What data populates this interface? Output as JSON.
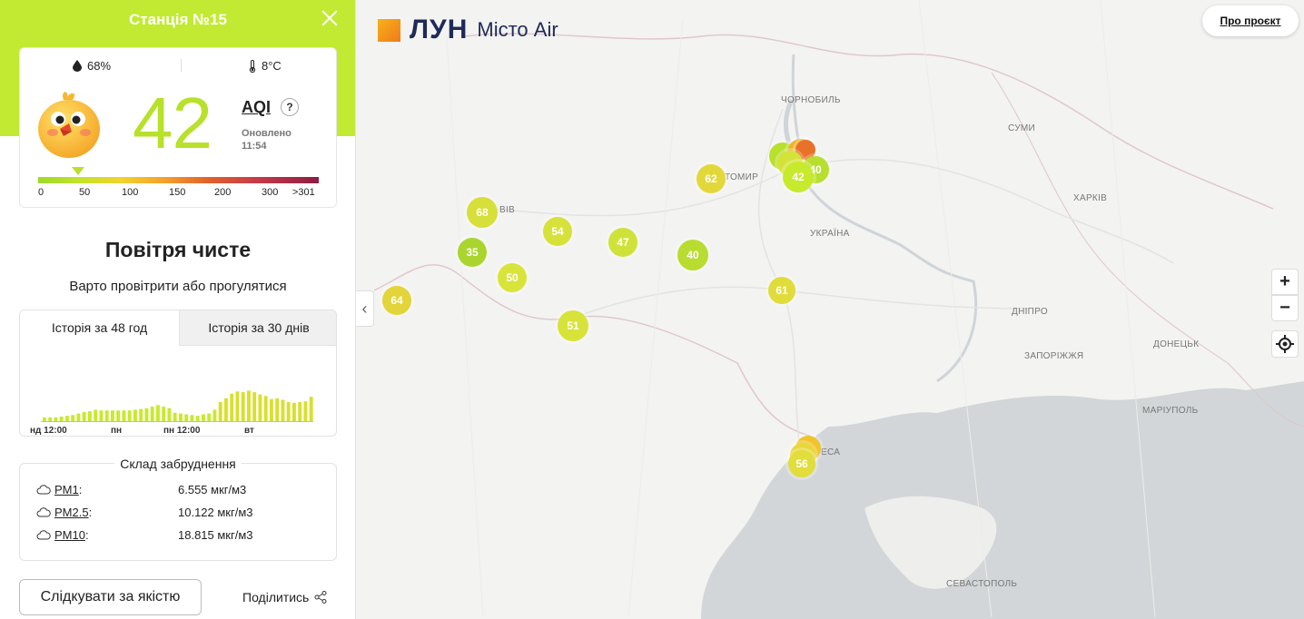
{
  "panel": {
    "title": "Станція №15",
    "humidity": "68%",
    "temperature": "8°C",
    "aqi_value": "42",
    "aqi_label": "AQI",
    "help": "?",
    "updated_label": "Оновлено",
    "updated_time": "11:54",
    "scale_ticks": [
      "0",
      "50",
      "100",
      "150",
      "200",
      "300",
      ">301"
    ],
    "status_title": "Повітря чисте",
    "status_sub": "Варто провітрити або прогулятися"
  },
  "history": {
    "tabs": [
      "Історія за 48 год",
      "Історія за 30 днів"
    ],
    "active_tab": 0,
    "time_labels": [
      "нд 12:00",
      "пн",
      "пн 12:00",
      "вт"
    ],
    "bars": [
      0.1,
      0.1,
      0.1,
      0.12,
      0.14,
      0.16,
      0.2,
      0.24,
      0.26,
      0.3,
      0.28,
      0.28,
      0.28,
      0.28,
      0.28,
      0.28,
      0.3,
      0.32,
      0.34,
      0.38,
      0.42,
      0.38,
      0.34,
      0.22,
      0.2,
      0.18,
      0.16,
      0.14,
      0.18,
      0.2,
      0.3,
      0.5,
      0.6,
      0.72,
      0.78,
      0.76,
      0.8,
      0.76,
      0.7,
      0.66,
      0.58,
      0.6,
      0.56,
      0.5,
      0.48,
      0.5,
      0.52,
      0.64
    ],
    "bar_colors": [
      "#c7ea2c",
      "#d8e02d"
    ]
  },
  "pollution": {
    "title": "Склад забруднення",
    "items": [
      {
        "name": "PM1",
        "value": "6.555 мкг/м3"
      },
      {
        "name": "PM2.5",
        "value": "10.122 мкг/м3"
      },
      {
        "name": "PM10",
        "value": "18.815 мкг/м3"
      }
    ]
  },
  "actions": {
    "follow": "Слідкувати за якістю",
    "share": "Поділитись"
  },
  "map": {
    "logo_main": "ЛУН",
    "logo_sub": "Місто Air",
    "about": "Про проєкт",
    "zoom_in": "+",
    "zoom_out": "−",
    "collapse_icon": "‹",
    "cities": [
      {
        "name": "ЧОРНОБИЛЬ"
      },
      {
        "name": "СУМИ"
      },
      {
        "name": "ТОМИР"
      },
      {
        "name": "ХАРКІВ"
      },
      {
        "name": "УКРАЇНА"
      },
      {
        "name": "ВІВ"
      },
      {
        "name": "ДНІПРО"
      },
      {
        "name": "ЗАПОРІЖЖЯ"
      },
      {
        "name": "ДОНЕЦЬК"
      },
      {
        "name": "МАРІУПОЛЬ"
      },
      {
        "name": "ЕСА"
      },
      {
        "name": "СЕВАСТОПОЛЬ"
      }
    ],
    "markers": [
      {
        "value": "68",
        "color": "#d7df3a"
      },
      {
        "value": "35",
        "color": "#a9d52e"
      },
      {
        "value": "54",
        "color": "#d6e13a"
      },
      {
        "value": "50",
        "color": "#d9e43b"
      },
      {
        "value": "47",
        "color": "#cfe23a"
      },
      {
        "value": "40",
        "color": "#b9dc30"
      },
      {
        "value": "62",
        "color": "#e3d83a"
      },
      {
        "value": "61",
        "color": "#e0dc3a"
      },
      {
        "value": "51",
        "color": "#d8e33a"
      },
      {
        "value": "64",
        "color": "#e3d43a"
      },
      {
        "value": "40",
        "color": "#b8df30"
      },
      {
        "value": "42",
        "color": "#c7ea2c"
      },
      {
        "value": "56",
        "color": "#e1dd3a"
      }
    ]
  }
}
